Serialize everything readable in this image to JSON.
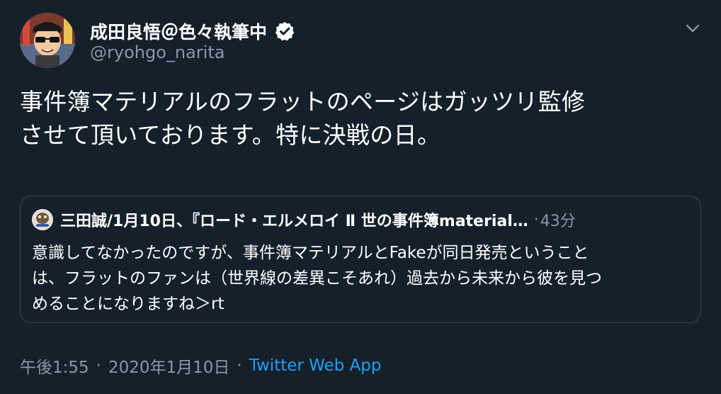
{
  "author": {
    "name": "成田良悟＠色々執筆中",
    "handle": "@ryohgo_narita",
    "verified": true,
    "avatar_icon": "user-avatar-icon"
  },
  "tweet": {
    "text": "事件簿マテリアルのフラットのページはガッツリ監修\nさせて頂いております。特に決戦の日。"
  },
  "quoted_tweet": {
    "author_name": "三田誠/1月10日、『ロード・エルメロイ Ⅱ 世の事件簿material…",
    "separator": "·",
    "time": "43分",
    "text": "意識してなかったのですが、事件簿マテリアルとFakeが同日発売ということ\nは、フラットのファンは（世界線の差異こそあれ）過去から未来から彼を見つ\nめることになりますね＞rt"
  },
  "footer": {
    "time": "午後1:55",
    "separator": "·",
    "date": "2020年1月10日",
    "source": "Twitter Web App"
  },
  "colors": {
    "background": "#15202b",
    "primary_text": "#ffffff",
    "secondary_text": "#8899a6",
    "accent": "#1da1f2",
    "border": "#38444d"
  }
}
